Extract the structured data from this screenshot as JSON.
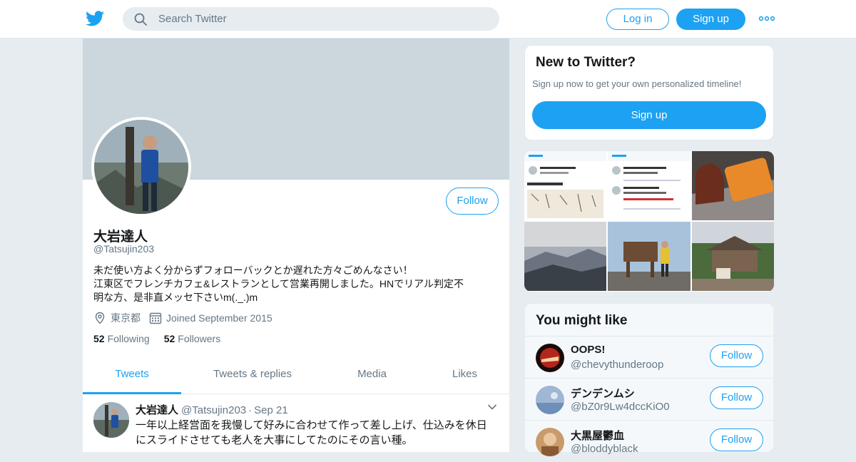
{
  "topbar": {
    "search_placeholder": "Search Twitter",
    "login_label": "Log in",
    "signup_label": "Sign up",
    "more_icon": "more-dots-icon"
  },
  "profile": {
    "name": "大岩達人",
    "handle": "@Tatsujin203",
    "follow_label": "Follow",
    "bio_lines": [
      "未だ使い方よく分からずフォローバックとか遅れた方々ごめんなさい！",
      "江東区でフレンチカフェ&レストランとして営業再開しました。HNでリアル判定不",
      "明な方、是非直メッセ下さいm(._.)m"
    ],
    "location": "東京都",
    "joined": "Joined September 2015",
    "following_count": "52",
    "following_label": "Following",
    "followers_count": "52",
    "followers_label": "Followers"
  },
  "tabs": [
    {
      "label": "Tweets",
      "active": true
    },
    {
      "label": "Tweets & replies",
      "active": false
    },
    {
      "label": "Media",
      "active": false
    },
    {
      "label": "Likes",
      "active": false
    }
  ],
  "tweet": {
    "name": "大岩達人",
    "handle": "@Tatsujin203",
    "dot": "·",
    "time": "Sep 21",
    "text_lines": [
      "一年以上経営面を我慢して好みに合わせて作って差し上げ、仕込みを休日",
      "にスライドさせても老人を大事にしてたのにその言い種。"
    ]
  },
  "new_to_twitter": {
    "title": "New to Twitter?",
    "subtitle": "Sign up now to get your own personalized timeline!",
    "button": "Sign up"
  },
  "you_might_like": {
    "title": "You might like",
    "follow_label": "Follow",
    "users": [
      {
        "name": "OOPS!",
        "handle": "@chevythunderoop"
      },
      {
        "name": "デンデンムシ",
        "handle": "@bZ0r9Lw4dccKiO0"
      },
      {
        "name": "大黒屋鬱血",
        "handle": "@bloddyblack"
      }
    ]
  },
  "colors": {
    "accent": "#1da1f2",
    "banner": "#ccd6dd",
    "muted_text": "#657786"
  }
}
